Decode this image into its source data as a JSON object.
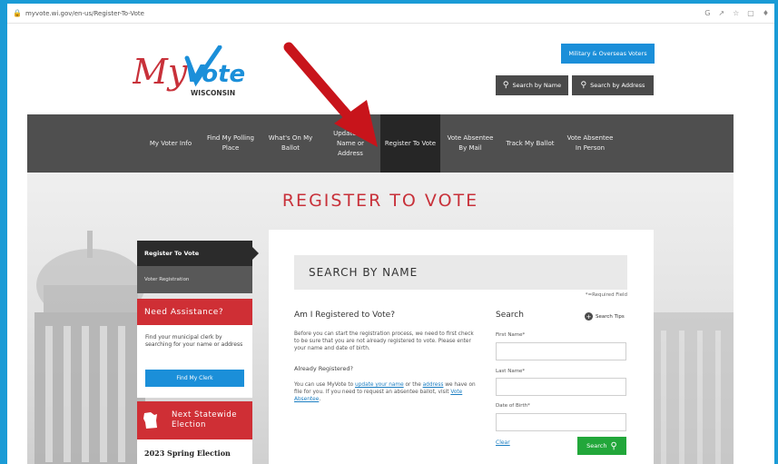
{
  "browser": {
    "url": "myvote.wi.gov/en-us/Register-To-Vote",
    "icons": [
      "google-icon",
      "share-icon",
      "star-icon",
      "sidebar-icon",
      "extension-icon"
    ]
  },
  "header": {
    "logo_text_script": "My",
    "logo_text_vote": "Vote",
    "logo_subtitle": "WISCONSIN",
    "military_button": "Military & Overseas Voters",
    "search_by_name": "Search by Name",
    "search_by_address": "Search by Address"
  },
  "nav": {
    "items": [
      {
        "label": "My Voter Info"
      },
      {
        "label": "Find My Polling Place"
      },
      {
        "label": "What's On My Ballot"
      },
      {
        "label": "Update My Name or Address"
      },
      {
        "label": "Register To Vote"
      },
      {
        "label": "Vote Absentee By Mail"
      },
      {
        "label": "Track My Ballot"
      },
      {
        "label": "Vote Absentee In Person"
      }
    ],
    "active_index": 4
  },
  "page": {
    "title": "REGISTER TO VOTE"
  },
  "sidebar": {
    "section_title": "Register To Vote",
    "section_sub": "Voter Registration",
    "assist_title": "Need Assistance?",
    "assist_text": "Find your municipal clerk by searching for your name or address",
    "find_clerk": "Find My Clerk",
    "election_title": "Next Statewide Election",
    "election_name": "2023 Spring Election"
  },
  "main": {
    "section_title": "SEARCH BY NAME",
    "required_note": "*=Required Field",
    "question": "Am I Registered to Vote?",
    "question_text": "Before you can start the registration process, we need to first check to be sure that you are not already registered to vote. Please enter your name and date of birth.",
    "already": "Already Registered?",
    "already_text_1": "You can use MyVote to ",
    "already_link_1": "update your name",
    "already_text_2": " or the ",
    "already_link_2": "address",
    "already_text_3": " we have on file for you. If you need to request an absentee ballot, visit ",
    "already_link_3": "Vote Absentee",
    "already_text_4": "."
  },
  "search_form": {
    "title": "Search",
    "tips": "Search Tips",
    "first_name_label": "First Name*",
    "first_name_value": "",
    "last_name_label": "Last Name*",
    "last_name_value": "",
    "dob_label": "Date of Birth*",
    "dob_value": "",
    "clear": "Clear",
    "submit": "Search"
  },
  "colors": {
    "frame": "#1a9bd6",
    "nav_bg": "#4f4f4f",
    "nav_active": "#262626",
    "accent_red": "#cf2f35",
    "accent_blue": "#1b8fd9",
    "accent_green": "#22a73a",
    "annotation_arrow": "#c8141b"
  }
}
